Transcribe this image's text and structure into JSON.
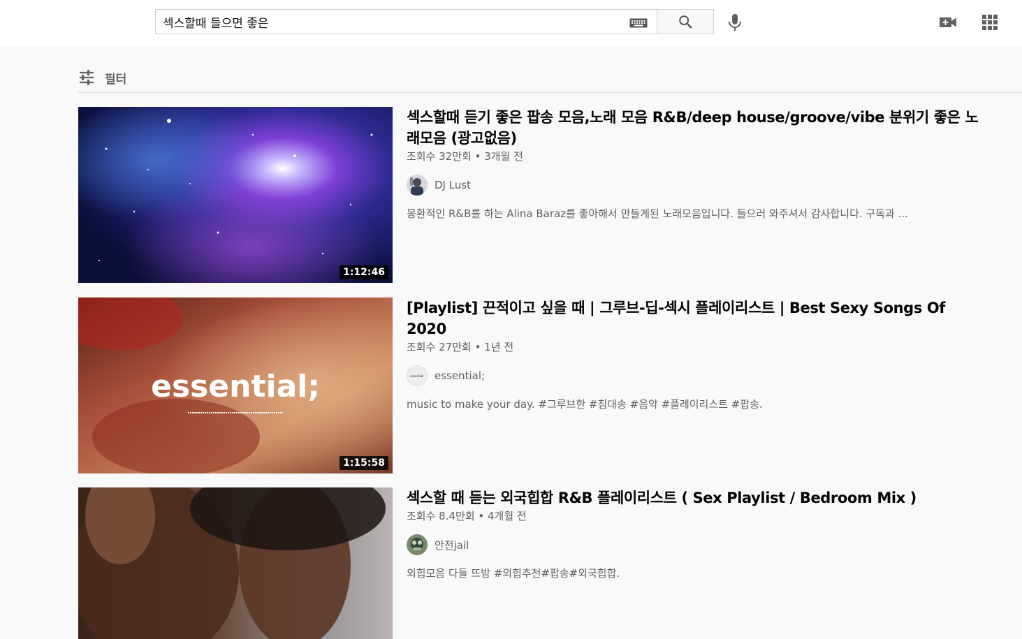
{
  "search": {
    "query": "섹스할때 들으면 좋은",
    "keyboard_icon": "keyboard-icon",
    "search_icon": "search-icon"
  },
  "header": {
    "mic_icon": "microphone-icon",
    "create_icon": "video-camera-plus-icon",
    "apps_icon": "apps-grid-icon"
  },
  "filter": {
    "label": "필터",
    "icon": "tune-icon"
  },
  "results": [
    {
      "title": "섹스할때 듣기 좋은 팝송 모음,노래 모음 R&B/deep house/groove/vibe 분위기 좋은 노래모음 (광고없음)",
      "meta": "조회수 32만회 • 3개월 전",
      "channel": "DJ Lust",
      "description": "몽환적인 R&B를 하는 Alina Baraz를 좋아해서 만들게된 노래모음입니다. 들으러 와주셔서 감사합니다. 구독과 ...",
      "duration": "1:12:46"
    },
    {
      "title": "[Playlist] 끈적이고 싶을 때 | 그루브-딥-섹시 플레이리스트 | Best Sexy Songs Of 2020",
      "meta": "조회수 27만회 • 1년 전",
      "channel": "essential;",
      "description": "music to make your day. #그루브한 #침대송 #음악 #플레이리스트 #팝송.",
      "duration": "1:15:58",
      "thumbnail_text": "essential;",
      "avatar_text": "essential;"
    },
    {
      "title": "섹스할 때 듣는 외국힙합 R&B 플레이리스트 ( Sex Playlist / Bedroom Mix )",
      "meta": "조회수 8.4만회 • 4개월 전",
      "channel": "안전jail",
      "description": "외힙모음 다들 뜨밤 #외힙추천#팝송#외국힙합."
    }
  ]
}
